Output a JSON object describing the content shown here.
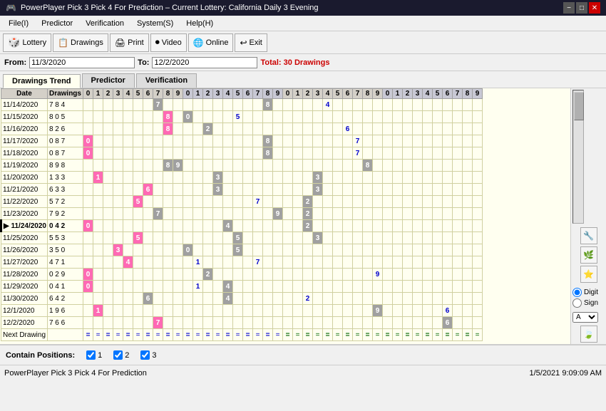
{
  "titleBar": {
    "title": "PowerPlayer Pick 3 Pick 4 For Prediction – Current Lottery: California Daily 3 Evening",
    "minBtn": "−",
    "maxBtn": "□",
    "closeBtn": "✕"
  },
  "menuBar": {
    "items": [
      "File(I)",
      "Predictor",
      "Verification",
      "System(S)",
      "Help(H)"
    ]
  },
  "toolbar": {
    "buttons": [
      "Lottery",
      "Drawings",
      "Print",
      "Video",
      "Online",
      "Exit"
    ]
  },
  "dateBar": {
    "fromLabel": "From:",
    "fromDate": "11/3/2020",
    "toLabel": "To:",
    "toDate": "12/2/2020",
    "totalLabel": "Total: 30 Drawings"
  },
  "tabs": [
    "Drawings Trend",
    "Predictor",
    "Verification"
  ],
  "activeTab": 0,
  "table": {
    "headers": [
      "Date",
      "Drawings",
      "0",
      "1",
      "2",
      "3",
      "4",
      "5",
      "6",
      "7",
      "8",
      "9",
      "0",
      "1",
      "2",
      "3",
      "4",
      "5",
      "6",
      "7",
      "8",
      "9",
      "0",
      "1",
      "2",
      "3",
      "4",
      "5",
      "6",
      "7",
      "8",
      "9",
      "0",
      "1",
      "2",
      "3",
      "4",
      "5",
      "6",
      "7",
      "8",
      "9"
    ],
    "rows": [
      {
        "date": "11/14/2020",
        "draw": "7 8 4",
        "cells": {
          "28": "7",
          "38": "8",
          "14": "4"
        },
        "types": {
          "28": "gray",
          "38": "gray",
          "14": "blue"
        }
      },
      {
        "date": "11/15/2020",
        "draw": "8 0 5",
        "cells": {
          "8": "8",
          "10": "0",
          "15": "5"
        },
        "types": {
          "8": "pink",
          "10": "gray",
          "15": "blue"
        }
      },
      {
        "date": "11/16/2020",
        "draw": "8 2 6",
        "cells": {
          "8": "8",
          "12": "2",
          "36": "6"
        },
        "types": {
          "8": "pink",
          "12": "gray",
          "36": "blue"
        }
      },
      {
        "date": "11/17/2020",
        "draw": "0 8 7",
        "cells": {
          "0": "0",
          "28": "8",
          "37": "7"
        },
        "types": {
          "0": "pink",
          "28": "gray",
          "37": "blue"
        }
      },
      {
        "date": "11/18/2020",
        "draw": "0 8 7",
        "cells": {
          "0": "0",
          "28": "8",
          "37": "7"
        },
        "types": {
          "0": "pink",
          "28": "gray",
          "37": "blue"
        }
      },
      {
        "date": "11/19/2020",
        "draw": "8 9 8",
        "cells": {
          "8": "8",
          "19": "9",
          "28": "8"
        },
        "types": {
          "8": "gray",
          "19": "gray",
          "28": "gray"
        }
      },
      {
        "date": "11/20/2020",
        "draw": "1 3 3",
        "cells": {
          "1": "1",
          "13": "3",
          "23": "3"
        },
        "types": {
          "1": "pink",
          "13": "gray",
          "23": "gray"
        }
      },
      {
        "date": "11/21/2020",
        "draw": "6 3 3",
        "cells": {
          "6": "6",
          "13": "3",
          "23": "3"
        },
        "types": {
          "6": "pink",
          "13": "gray",
          "23": "gray"
        }
      },
      {
        "date": "11/22/2020",
        "draw": "5 7 2",
        "cells": {
          "5": "5",
          "27": "7",
          "12": "2"
        },
        "types": {
          "5": "pink",
          "27": "blue",
          "12": "gray"
        }
      },
      {
        "date": "11/23/2020",
        "draw": "7 9 2",
        "cells": {
          "7": "7",
          "19": "9",
          "22": "2"
        },
        "types": {
          "7": "gray",
          "19": "gray",
          "22": "gray"
        }
      },
      {
        "date": "11/24/2020",
        "draw": "0 4 2",
        "cells": {
          "0": "0",
          "14": "4",
          "22": "2"
        },
        "types": {
          "0": "pink",
          "14": "gray",
          "22": "gray"
        },
        "current": true
      },
      {
        "date": "11/25/2020",
        "draw": "5 5 3",
        "cells": {
          "5": "5",
          "15": "5",
          "23": "3"
        },
        "types": {
          "5": "pink",
          "15": "gray",
          "23": "gray"
        }
      },
      {
        "date": "11/26/2020",
        "draw": "3 5 0",
        "cells": {
          "3": "3",
          "15": "5",
          "10": "0"
        },
        "types": {
          "3": "pink",
          "15": "gray",
          "10": "gray"
        }
      },
      {
        "date": "11/27/2020",
        "draw": "4 7 1",
        "cells": {
          "4": "4",
          "17": "7",
          "11": "1"
        },
        "types": {
          "4": "pink",
          "17": "blue",
          "11": "blue"
        }
      },
      {
        "date": "11/28/2020",
        "draw": "0 2 9",
        "cells": {
          "0": "0",
          "12": "2",
          "29": "9"
        },
        "types": {
          "0": "pink",
          "12": "gray",
          "29": "blue"
        }
      },
      {
        "date": "11/29/2020",
        "draw": "0 4 1",
        "cells": {
          "0": "0",
          "14": "4",
          "11": "1"
        },
        "types": {
          "0": "pink",
          "14": "gray",
          "11": "blue"
        }
      },
      {
        "date": "11/30/2020",
        "draw": "6 4 2",
        "cells": {
          "6": "6",
          "14": "4",
          "22": "2"
        },
        "types": {
          "6": "gray",
          "14": "gray",
          "22": "blue"
        }
      },
      {
        "date": "12/1/2020",
        "draw": "1 9 6",
        "cells": {
          "1": "1",
          "29": "9",
          "36": "6"
        },
        "types": {
          "1": "pink",
          "29": "gray",
          "36": "blue"
        }
      },
      {
        "date": "12/2/2020",
        "draw": "7 6 6",
        "cells": {
          "7": "7",
          "36": "6",
          "36b": "6"
        },
        "types": {
          "7": "pink",
          "36": "gray",
          "36b": "blue"
        }
      },
      {
        "date": "Next Drawing",
        "draw": "",
        "cells": {},
        "types": {},
        "isNext": true
      }
    ]
  },
  "rightPanel": {
    "buttons": [
      "🔧",
      "🌿",
      "⭐"
    ],
    "radioOptions": [
      "Digit",
      "Sign"
    ],
    "selectedRadio": "Digit",
    "dropdownValue": "A"
  },
  "containPositions": {
    "label": "Contain Positions:",
    "options": [
      {
        "checked": true,
        "label": "1"
      },
      {
        "checked": true,
        "label": "2"
      },
      {
        "checked": true,
        "label": "3"
      }
    ]
  },
  "statusBar": {
    "left": "PowerPlayer Pick 3 Pick 4 For Prediction",
    "right": "1/5/2021  9:09:09 AM"
  }
}
